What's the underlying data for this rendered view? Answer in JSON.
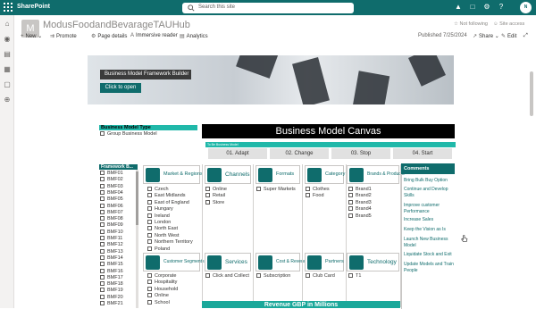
{
  "topbar": {
    "app": "SharePoint",
    "search_placeholder": "Search this site",
    "avatar": "N"
  },
  "site": {
    "title": "ModusFoodandBevarageTAUHub",
    "not_following": "Not following",
    "site_access": "Site access",
    "logo": "M"
  },
  "commands": {
    "new": "New",
    "promote": "Promote",
    "page_details": "Page details",
    "immersive": "Immersive reader",
    "analytics": "Analytics",
    "published": "Published 7/25/2024",
    "share": "Share",
    "edit": "Edit"
  },
  "banner": {
    "title": "Business Model Framework Builder",
    "button": "Click to open"
  },
  "model_type": {
    "header": "Business Model Type",
    "option": "Group Business Model"
  },
  "canvas": {
    "title": "Business Model Canvas",
    "tobe": "To Be Business Model",
    "steps": [
      "01. Adapt",
      "02. Change",
      "03. Stop",
      "04. Start"
    ]
  },
  "framework": {
    "header": "Framework B...",
    "items": [
      "BMF01",
      "BMF02",
      "BMF03",
      "BMF04",
      "BMF05",
      "BMF06",
      "BMF07",
      "BMF08",
      "BMF09",
      "BMF10",
      "BMF11",
      "BMF12",
      "BMF13",
      "BMF14",
      "BMF15",
      "BMF16",
      "BMF17",
      "BMF18",
      "BMF19",
      "BMF20",
      "BMF21"
    ]
  },
  "tiles": {
    "market": "Market & Regions",
    "channels": "Channels",
    "formats": "Formats",
    "category": "Category",
    "brands": "Brands & Products",
    "customer": "Customer Segments",
    "services": "Services",
    "cost": "Cost & Revenue",
    "partners": "Partners",
    "technology": "Technology"
  },
  "regions": [
    "Czech",
    "East Midlands",
    "East of England",
    "Hungary",
    "Ireland",
    "London",
    "North East",
    "North West",
    "Northern Territory",
    "Poland"
  ],
  "channels": [
    "Online",
    "Retail",
    "Store"
  ],
  "formats": [
    "Super Markets"
  ],
  "category": [
    "Clothes",
    "Food"
  ],
  "brands": [
    "Brand1",
    "Brand2",
    "Brand3",
    "Brand4",
    "Brand5"
  ],
  "segments": [
    "Corporate",
    "Hospitality",
    "Household",
    "Online",
    "School"
  ],
  "services": [
    "Click and Collect"
  ],
  "cost": [
    "Subscription"
  ],
  "partners": [
    "Club Card"
  ],
  "technology": [
    "T1"
  ],
  "comments": {
    "header": "Comments",
    "items": [
      "Bring Bulk Buy Option",
      "Continue and Develop Skills",
      "Improve customer Performance",
      "Increase Sales",
      "Keep the Vision as Is",
      "Launch New Business Model",
      "Liquidate Stock and Exit",
      "Update Models and Train People"
    ]
  },
  "revenue": "Revenue GBP in Millions",
  "colors": {
    "teal": "#0f6c6c",
    "accent": "#20b8a9",
    "black": "#000000"
  }
}
